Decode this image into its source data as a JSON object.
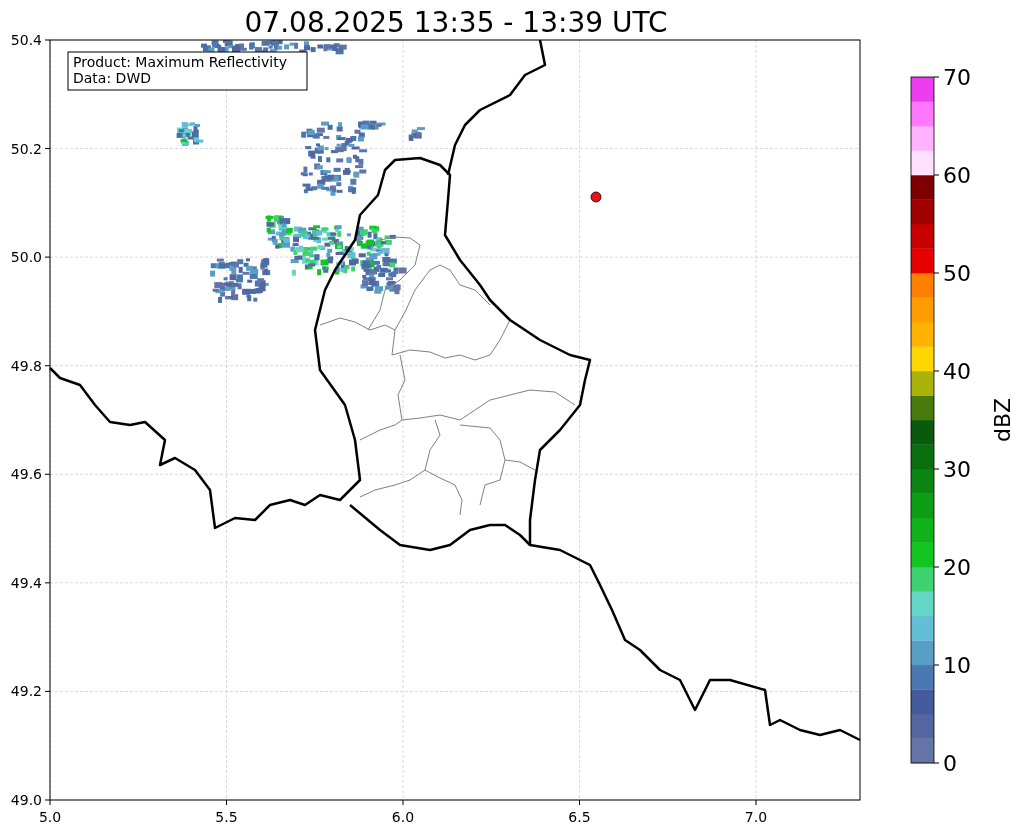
{
  "title": "07.08.2025 13:35 - 13:39 UTC",
  "map": {
    "info_box": [
      "Product: Maximum Reflectivity",
      "Data: DWD"
    ],
    "x_ticks": [
      "5.0",
      "5.5",
      "6.0",
      "6.5",
      "7.0"
    ],
    "y_ticks": [
      "50.4",
      "50.2",
      "50.0",
      "49.8",
      "49.6",
      "49.4",
      "49.2",
      "49.0"
    ]
  },
  "colorbar": {
    "label": "dBZ",
    "ticks": [
      "70",
      "60",
      "50",
      "40",
      "30",
      "20",
      "10",
      "0"
    ],
    "bands": [
      {
        "color": "#6474a6"
      },
      {
        "color": "#5466a0"
      },
      {
        "color": "#435a9c"
      },
      {
        "color": "#4a78b0"
      },
      {
        "color": "#5a9ec6"
      },
      {
        "color": "#62bdd6"
      },
      {
        "color": "#64d6c6"
      },
      {
        "color": "#3fd270"
      },
      {
        "color": "#12c520"
      },
      {
        "color": "#0fb318"
      },
      {
        "color": "#0d9d15"
      },
      {
        "color": "#0b8512"
      },
      {
        "color": "#0a700f"
      },
      {
        "color": "#0a5a0d"
      },
      {
        "color": "#477a0b"
      },
      {
        "color": "#aab20a"
      },
      {
        "color": "#ffd700"
      },
      {
        "color": "#ffb300"
      },
      {
        "color": "#ff9c00"
      },
      {
        "color": "#ff7f00"
      },
      {
        "color": "#e60000"
      },
      {
        "color": "#c80000"
      },
      {
        "color": "#a00000"
      },
      {
        "color": "#7e0000"
      },
      {
        "color": "#ffe0ff"
      },
      {
        "color": "#ffb3ff"
      },
      {
        "color": "#ff78ff"
      },
      {
        "color": "#ee3dee"
      }
    ]
  }
}
